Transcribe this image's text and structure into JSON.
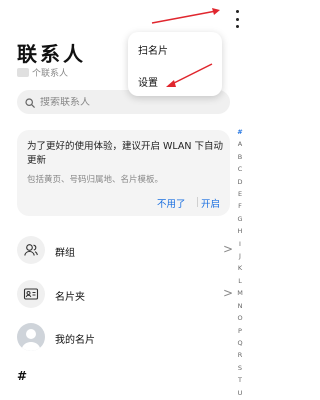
{
  "header": {
    "title": "联系人",
    "contact_count": "个联系人"
  },
  "search": {
    "placeholder": "搜索联系人"
  },
  "wlan_card": {
    "message": "为了更好的使用体验，建议开启 WLAN 下自动更新",
    "detail": "包括黄页、号码归属地、名片模板。",
    "decline": "不用了",
    "enable": "开启"
  },
  "list": {
    "groups": "群组",
    "card_holder": "名片夹",
    "my_card": "我的名片",
    "section_hash": "#"
  },
  "overflow_menu": {
    "items": [
      "扫名片",
      "设置"
    ]
  },
  "alpha_index": [
    "#",
    "A",
    "B",
    "C",
    "D",
    "E",
    "F",
    "G",
    "H",
    "I",
    "J",
    "K",
    "L",
    "M",
    "N",
    "O",
    "P",
    "Q",
    "R",
    "S",
    "T",
    "U"
  ],
  "colors": {
    "accent": "#1a6fe0",
    "annotation_arrow": "#e0262e"
  }
}
